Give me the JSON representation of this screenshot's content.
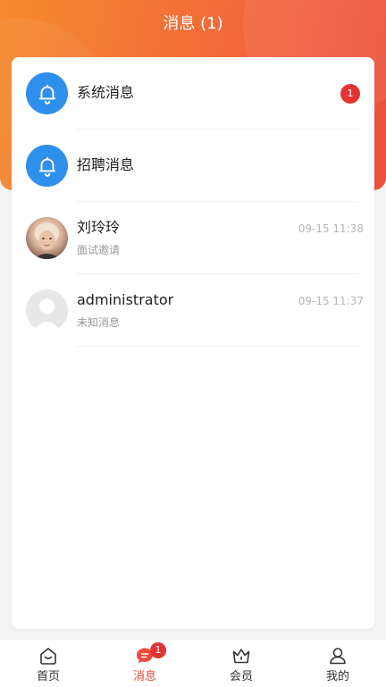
{
  "header": {
    "title": "消息 (1)"
  },
  "messages": [
    {
      "title": "系统消息",
      "icon": "bell-icon",
      "badge": "1"
    },
    {
      "title": "招聘消息",
      "icon": "bell-icon"
    },
    {
      "title": "刘玲玲",
      "subtitle": "面试邀请",
      "time": "09-15 11:38"
    },
    {
      "title": "administrator",
      "subtitle": "未知消息",
      "time": "09-15 11:37"
    }
  ],
  "tabbar": {
    "items": [
      {
        "label": "首页",
        "icon": "home-icon"
      },
      {
        "label": "消息",
        "icon": "message-icon",
        "badge": "1",
        "active": true
      },
      {
        "label": "会员",
        "icon": "crown-icon"
      },
      {
        "label": "我的",
        "icon": "user-icon"
      }
    ]
  },
  "colors": {
    "header_start": "#f58a2e",
    "header_end": "#ec4f3e",
    "accent": "#e94a3b",
    "bell_blue": "#2f8fec",
    "badge_red": "#e43333"
  }
}
